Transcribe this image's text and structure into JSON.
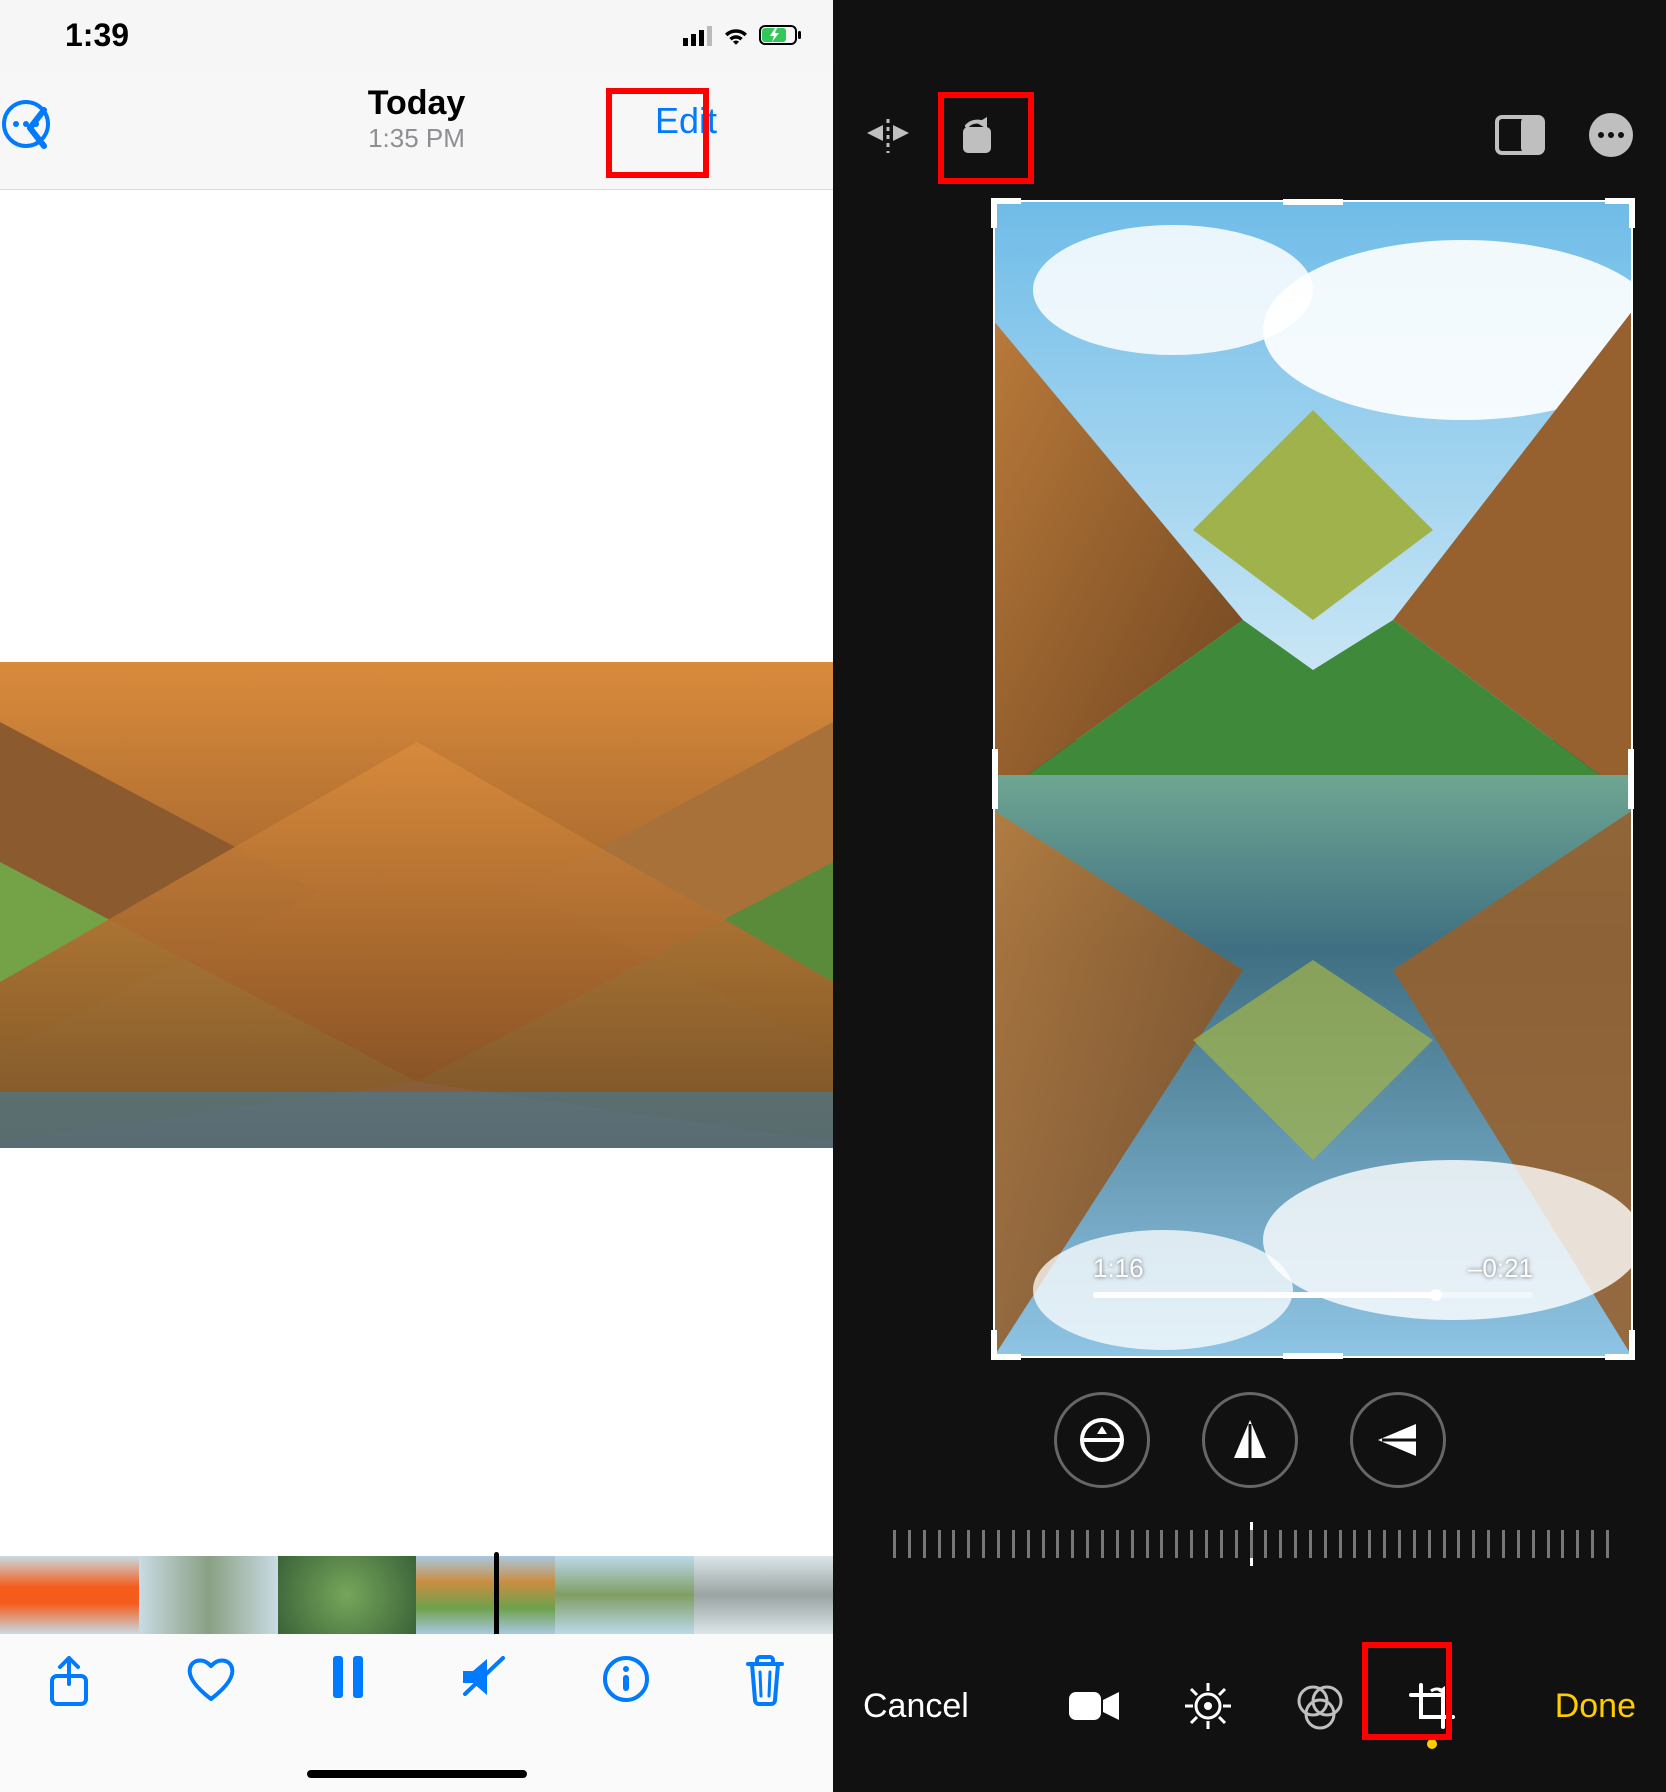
{
  "left": {
    "status": {
      "time": "1:39"
    },
    "header": {
      "title": "Today",
      "subtitle": "1:35 PM",
      "edit_label": "Edit"
    }
  },
  "right": {
    "playback": {
      "elapsed": "1:16",
      "remaining": "–0:21"
    },
    "toolbar": {
      "cancel_label": "Cancel",
      "done_label": "Done"
    }
  }
}
